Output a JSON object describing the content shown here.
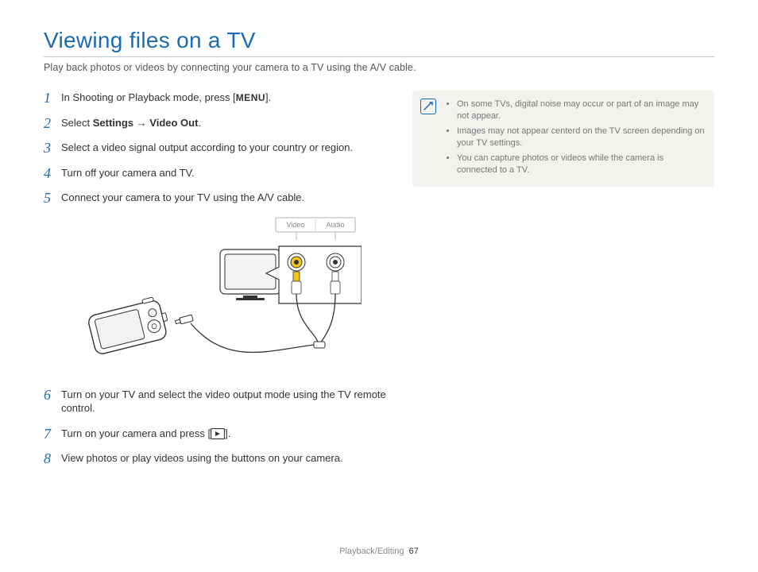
{
  "title": "Viewing files on a TV",
  "subtitle": "Play back photos or videos by connecting your camera to a TV using the A/V cable.",
  "steps": {
    "s1": {
      "pre": "In Shooting or Playback mode, press [",
      "btn": "MENU",
      "post": "]."
    },
    "s2": {
      "pre": "Select ",
      "b1": "Settings",
      "arrow": " → ",
      "b2": "Video Out",
      "post": "."
    },
    "s3": "Select a video signal output according to your country or region.",
    "s4": "Turn off your camera and TV.",
    "s5": "Connect your camera to your TV using the A/V cable.",
    "s6": "Turn on your TV and select the video output mode using the TV remote control.",
    "s7": {
      "pre": "Turn on your camera and press [",
      "post": "]."
    },
    "s8": "View photos or play videos using the buttons on your camera."
  },
  "diagram": {
    "video": "Video",
    "audio": "Audio"
  },
  "notes": {
    "n1": "On some TVs, digital noise may occur or part of an image may not appear.",
    "n2": "Images may not appear centerd on the TV screen depending on your TV settings.",
    "n3": "You can capture photos or videos while the camera is connected to a TV."
  },
  "footer": {
    "section": "Playback/Editing",
    "page": "67"
  }
}
